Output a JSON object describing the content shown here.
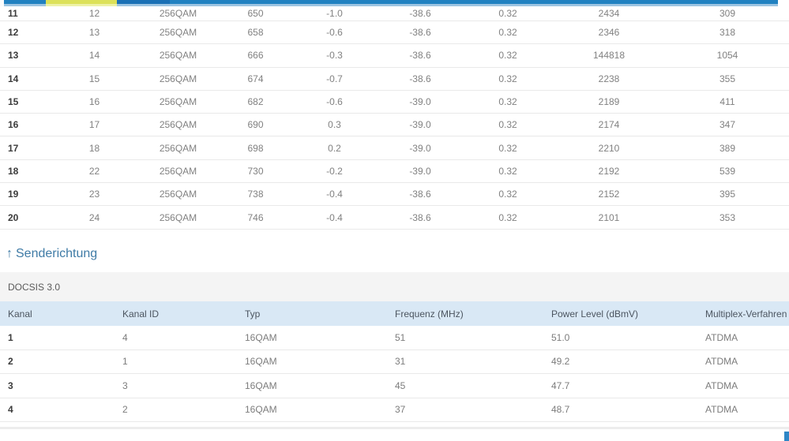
{
  "theme": {
    "bar_blue": "#2181c1",
    "bar_blue_dark": "#1a70b5",
    "bar_blue_light": "#9dc4e2",
    "bar_yellow": "#dce159",
    "bar_yellow_light": "#eef2a6",
    "heading_blue": "#3f7ba6",
    "header_row_bg": "#d9e8f5",
    "section_bar_bg": "#f4f4f4",
    "scroll_thumb": "#2e86c6"
  },
  "downstream_table": {
    "rows": [
      [
        "11",
        "12",
        "256QAM",
        "650",
        "-1.0",
        "-38.6",
        "0.32",
        "2434",
        "309"
      ],
      [
        "12",
        "13",
        "256QAM",
        "658",
        "-0.6",
        "-38.6",
        "0.32",
        "2346",
        "318"
      ],
      [
        "13",
        "14",
        "256QAM",
        "666",
        "-0.3",
        "-38.6",
        "0.32",
        "144818",
        "1054"
      ],
      [
        "14",
        "15",
        "256QAM",
        "674",
        "-0.7",
        "-38.6",
        "0.32",
        "2238",
        "355"
      ],
      [
        "15",
        "16",
        "256QAM",
        "682",
        "-0.6",
        "-39.0",
        "0.32",
        "2189",
        "411"
      ],
      [
        "16",
        "17",
        "256QAM",
        "690",
        "0.3",
        "-39.0",
        "0.32",
        "2174",
        "347"
      ],
      [
        "17",
        "18",
        "256QAM",
        "698",
        "0.2",
        "-39.0",
        "0.32",
        "2210",
        "389"
      ],
      [
        "18",
        "22",
        "256QAM",
        "730",
        "-0.2",
        "-39.0",
        "0.32",
        "2192",
        "539"
      ],
      [
        "19",
        "23",
        "256QAM",
        "738",
        "-0.4",
        "-38.6",
        "0.32",
        "2152",
        "395"
      ],
      [
        "20",
        "24",
        "256QAM",
        "746",
        "-0.4",
        "-38.6",
        "0.32",
        "2101",
        "353"
      ]
    ]
  },
  "upstream": {
    "arrow": "↑",
    "heading": "Senderichtung",
    "subheading": "DOCSIS 3.0",
    "headers": [
      "Kanal",
      "Kanal ID",
      "Typ",
      "Frequenz (MHz)",
      "Power Level (dBmV)",
      "Multiplex-Verfahren"
    ],
    "rows": [
      [
        "1",
        "4",
        "16QAM",
        "51",
        "51.0",
        "ATDMA"
      ],
      [
        "2",
        "1",
        "16QAM",
        "31",
        "49.2",
        "ATDMA"
      ],
      [
        "3",
        "3",
        "16QAM",
        "45",
        "47.7",
        "ATDMA"
      ],
      [
        "4",
        "2",
        "16QAM",
        "37",
        "48.7",
        "ATDMA"
      ]
    ]
  }
}
